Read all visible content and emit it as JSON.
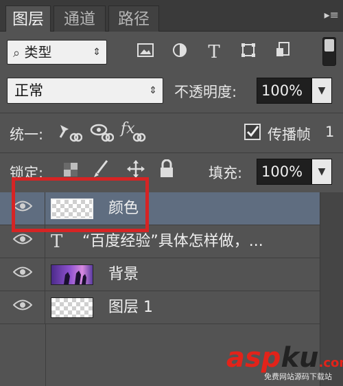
{
  "tabs": [
    {
      "label": "图层",
      "active": true
    },
    {
      "label": "通道",
      "active": false
    },
    {
      "label": "路径",
      "active": false
    }
  ],
  "filter": {
    "selected": "类型",
    "icons": [
      "image-filter-icon",
      "adjustment-filter-icon",
      "type-filter-icon",
      "shape-filter-icon",
      "smart-object-filter-icon"
    ]
  },
  "blend": {
    "mode": "正常",
    "opacity_label": "不透明度:",
    "opacity_value": "100%"
  },
  "unify": {
    "label": "统一:",
    "propagate_label": "传播帧",
    "propagate_value": "1",
    "propagate_checked": true
  },
  "lock": {
    "label": "锁定:",
    "fill_label": "填充:",
    "fill_value": "100%"
  },
  "layers": [
    {
      "name": "颜色",
      "type": "pixel",
      "selected": true
    },
    {
      "name": "“百度经验”具体怎样做，...",
      "type": "text",
      "selected": false
    },
    {
      "name": "背景",
      "type": "image",
      "selected": false
    },
    {
      "name": "图层 1",
      "type": "pixel",
      "selected": false
    }
  ],
  "watermark": {
    "brand_a": "asp",
    "brand_b": "ku",
    "suffix": ".com",
    "tagline": "免费网站源码下载站"
  },
  "colors": {
    "highlight": "#d62424",
    "selected_row": "#5f6d80"
  }
}
